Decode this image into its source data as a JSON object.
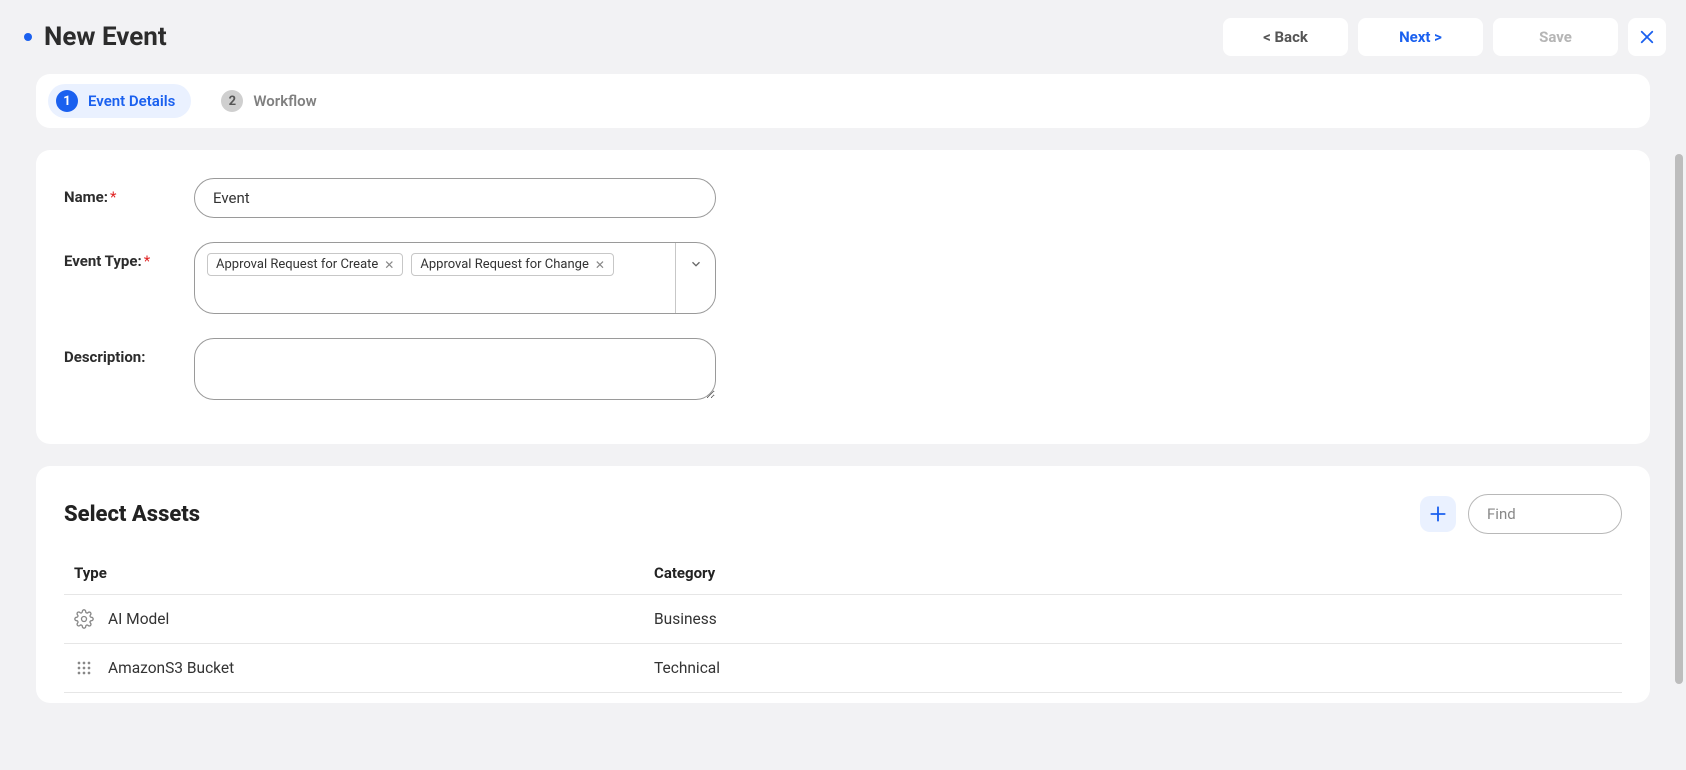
{
  "header": {
    "title": "New Event",
    "back_label": "< Back",
    "next_label": "Next >",
    "save_label": "Save"
  },
  "steps": {
    "items": [
      {
        "num": "1",
        "label": "Event Details"
      },
      {
        "num": "2",
        "label": "Workflow"
      }
    ]
  },
  "form": {
    "name_label": "Name:",
    "name_value": "Event",
    "type_label": "Event Type:",
    "type_tags": [
      "Approval Request for Create",
      "Approval Request for Change"
    ],
    "desc_label": "Description:",
    "desc_value": ""
  },
  "assets": {
    "title": "Select Assets",
    "find_placeholder": "Find",
    "columns": {
      "type": "Type",
      "category": "Category"
    },
    "rows": [
      {
        "type": "AI Model",
        "category": "Business",
        "icon": "gear"
      },
      {
        "type": "AmazonS3 Bucket",
        "category": "Technical",
        "icon": "grid"
      }
    ]
  }
}
